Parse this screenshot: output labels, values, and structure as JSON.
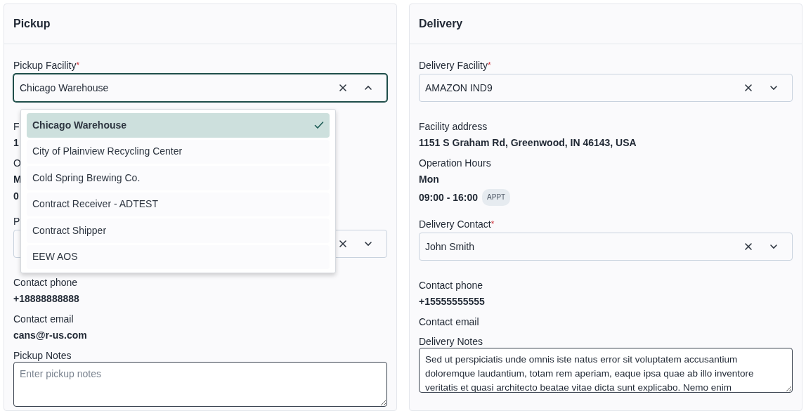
{
  "panels": [
    {
      "title": "Pickup",
      "fields": [
        {
          "kind": "select",
          "label": "Pickup Facility",
          "required_mark": "*",
          "value": "Chicago Warehouse",
          "expanded": true,
          "options": [
            {
              "label": "Chicago Warehouse",
              "selected": true
            },
            {
              "label": "City of Plainview Recycling Center",
              "selected": false
            },
            {
              "label": "Cold Spring Brewing Co.",
              "selected": false
            },
            {
              "label": "Contract Receiver - ADTEST",
              "selected": false
            },
            {
              "label": "Contract Shipper",
              "selected": false
            },
            {
              "label": "EEW AOS",
              "selected": false
            }
          ]
        },
        {
          "kind": "info",
          "label": "F",
          "value": "1"
        },
        {
          "kind": "hours",
          "label": "O",
          "day": "M",
          "time": "0"
        },
        {
          "kind": "select",
          "label": "P",
          "expanded": false
        },
        {
          "kind": "info",
          "label": "Contact phone",
          "value": "+18888888888"
        },
        {
          "kind": "info",
          "label": "Contact email",
          "value": "cans@r-us.com"
        },
        {
          "kind": "textarea",
          "label": "Pickup Notes",
          "placeholder": "Enter pickup notes"
        }
      ]
    },
    {
      "title": "Delivery",
      "fields": [
        {
          "kind": "select",
          "label": "Delivery Facility",
          "required_mark": "*",
          "value": "AMAZON IND9",
          "expanded": false
        },
        {
          "kind": "info",
          "label": "Facility address",
          "value": "1151 S Graham Rd, Greenwood, IN 46143, USA"
        },
        {
          "kind": "hours",
          "label": "Operation Hours",
          "day": "Mon",
          "time": "09:00 - 16:00",
          "badge": "APPT"
        },
        {
          "kind": "select",
          "label": "Delivery Contact",
          "required_mark": "*",
          "value": "John Smith",
          "expanded": false
        },
        {
          "kind": "info",
          "label": "Contact phone",
          "value": "+15555555555"
        },
        {
          "kind": "info",
          "label": "Contact email"
        },
        {
          "kind": "textarea",
          "label": "Delivery Notes",
          "value": "Sed ut perspiciatis unde omnis iste natus error sit voluptatem accusantium doloremque laudantium, totam rem aperiam, eaque ipsa quae ab illo inventore veritatis et quasi architecto beatae vitae dicta sunt explicabo. Nemo enim"
        }
      ]
    }
  ]
}
